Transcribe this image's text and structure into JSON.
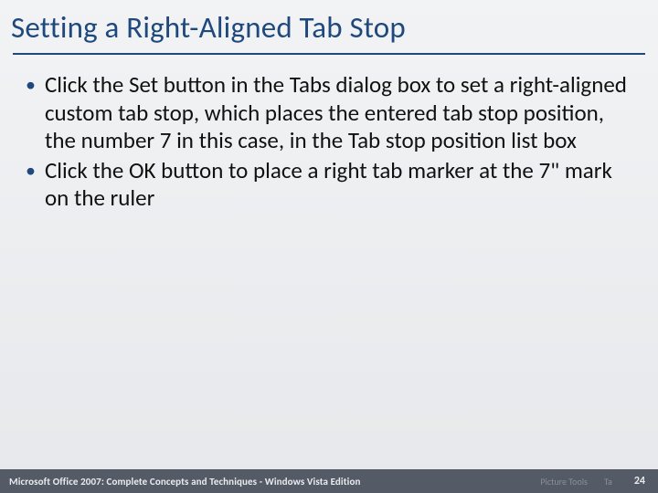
{
  "title": "Setting a Right-Aligned Tab Stop",
  "bullets": [
    "Click the Set button in the Tabs dialog box to set a right-aligned custom tab stop, which places the entered tab stop position, the number 7 in this case, in the Tab stop position list box",
    " Click the OK button to place a right tab marker at the 7\" mark on the ruler"
  ],
  "footer": {
    "source": "Microsoft Office 2007: Complete Concepts and Techniques - Windows Vista Edition",
    "ghost1": "Picture Tools",
    "ghost2": "Ta",
    "page": "24"
  }
}
